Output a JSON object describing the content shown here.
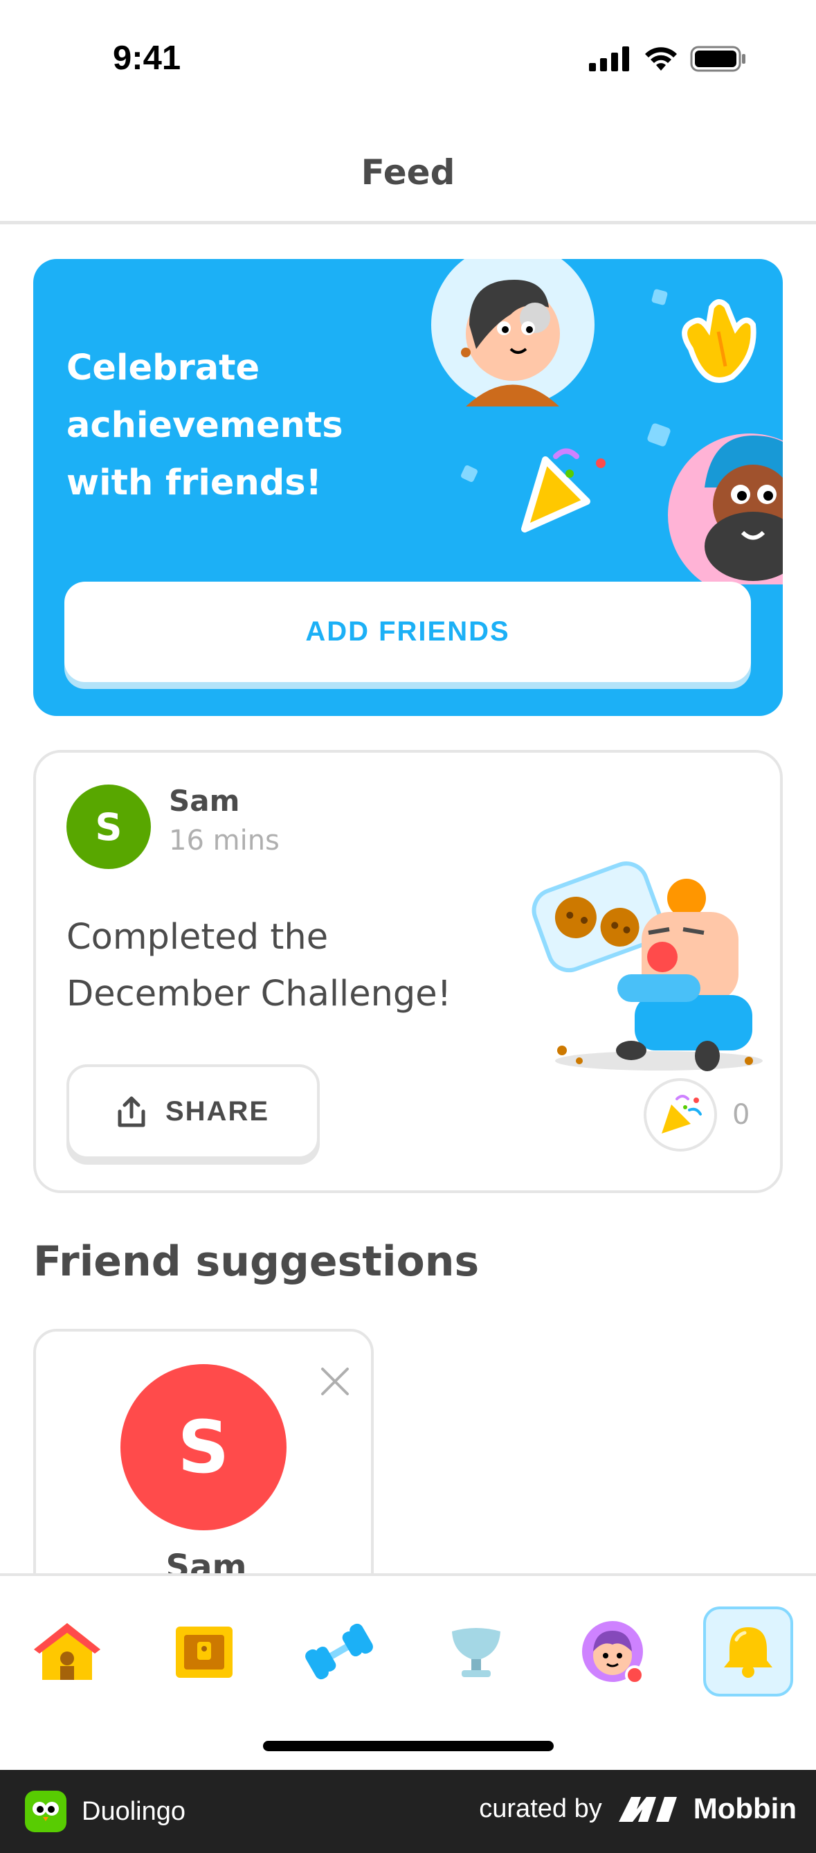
{
  "status_bar": {
    "time": "9:41"
  },
  "header": {
    "title": "Feed"
  },
  "promo": {
    "text_lines": [
      "Celebrate",
      "achievements",
      "with friends!"
    ],
    "button_label": "ADD FRIENDS"
  },
  "post": {
    "avatar_initial": "S",
    "user_name": "Sam",
    "time_ago": "16 mins",
    "message_lines": [
      "Completed the",
      "December Challenge!"
    ],
    "share_label": "SHARE",
    "reaction_count": "0"
  },
  "suggestions": {
    "title": "Friend suggestions",
    "items": [
      {
        "initial": "S",
        "name": "Sam"
      }
    ]
  },
  "tabbar": {
    "items": [
      {
        "icon": "home-icon",
        "active": false
      },
      {
        "icon": "treasure-chest-icon",
        "active": false
      },
      {
        "icon": "dumbbell-icon",
        "active": false
      },
      {
        "icon": "trophy-icon",
        "active": false
      },
      {
        "icon": "profile-avatar-icon",
        "active": false
      },
      {
        "icon": "bell-icon",
        "active": true
      }
    ]
  },
  "footer": {
    "app_name": "Duolingo",
    "curated_by": "curated by",
    "brand": "Mobbin"
  },
  "colors": {
    "accent_blue": "#1cb0f6",
    "green": "#58a700",
    "red": "#ff4b4b",
    "text_dark": "#4b4b4b",
    "text_muted": "#afafaf"
  }
}
